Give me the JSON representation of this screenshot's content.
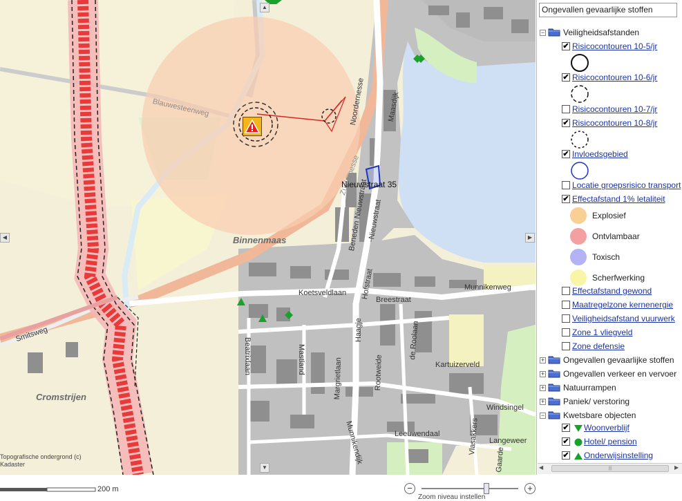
{
  "map": {
    "labels": {
      "blauwesteenweg": "Blauwesteenweg",
      "noordernesse": "Noordernesse",
      "maasdijk": "Maasdijk",
      "zuidernesse": "Zuidernesse",
      "nieuwstraat35": "Nieuwstraat 35",
      "binnenmaas": "Binnenmaas",
      "beneden_nieuwstraat": "Beneden Nieuwstraat",
      "nieuwstraat": "Nieuwstraat",
      "koetsveldlaan": "Koetsveldlaan",
      "hofstraat": "Hofstraat",
      "breestraat": "Breestraat",
      "munnikenweg": "Munnikenweg",
      "smitsweg": "Smitsweg",
      "beatrixlaan": "Beatrixlaan",
      "mastland": "Mastland",
      "margrietlaan": "Margrietlaan",
      "haagje": "Haagje",
      "rootweide": "Rootweide",
      "de_roolaan": "de Roolaan",
      "kartuizerveld": "Kartuizerveld",
      "cromstrijen": "Cromstrijen",
      "windsingel": "Windsingel",
      "leeuwendaal": "Leeuwendaal",
      "vlasakkers": "Vlasakkers",
      "langeweer": "Langeweer",
      "gaarde": "Gaarde",
      "munnikendijk": "Munnikendijk"
    },
    "copyright_line1": "Topografische ondergrond (c)",
    "copyright_line2": "Kadaster",
    "pan_up": "▲",
    "pan_down": "▼",
    "pan_left": "◀",
    "pan_right": "▶"
  },
  "scale": {
    "label": "200 m"
  },
  "zoom": {
    "minus": "−",
    "plus": "+",
    "level_fraction": 0.68,
    "caption": "Zoom niveau instellen"
  },
  "panel": {
    "selected_layer": "Ongevallen gevaarlijke stoffen",
    "groups": [
      {
        "label": "Veiligheidsafstanden",
        "expanded": true
      },
      {
        "label": "Ongevallen gevaarlijke stoffen",
        "expanded": false
      },
      {
        "label": "Ongevallen verkeer en vervoer",
        "expanded": false
      },
      {
        "label": "Natuurrampen",
        "expanded": false
      },
      {
        "label": "Paniek/ verstoring",
        "expanded": false
      },
      {
        "label": "Kwetsbare objecten",
        "expanded": true
      }
    ],
    "layers": [
      {
        "label": "Risicocontouren 10-5/jr",
        "checked": true
      },
      {
        "label": "Risicocontouren 10-6/jr",
        "checked": true
      },
      {
        "label": "Risicocontouren 10-7/jr",
        "checked": false
      },
      {
        "label": "Risicocontouren 10-8/jr",
        "checked": true
      },
      {
        "label": "Invloedsgebied",
        "checked": true
      },
      {
        "label": "Locatie groepsrisico transport",
        "checked": false
      },
      {
        "label": "Effectafstand 1% letaliteit",
        "checked": true
      },
      {
        "label": "Effectafstand gewond",
        "checked": false
      },
      {
        "label": "Maatregelzone kernenergie",
        "checked": false
      },
      {
        "label": "Veiligheidsafstand vuurwerk",
        "checked": false
      },
      {
        "label": "Zone 1 vliegveld",
        "checked": false
      },
      {
        "label": "Zone defensie",
        "checked": false
      }
    ],
    "effect_legend": [
      {
        "label": "Explosief",
        "color": "#f9cf93"
      },
      {
        "label": "Ontvlambaar",
        "color": "#f5a0a0"
      },
      {
        "label": "Toxisch",
        "color": "#b3b3f5"
      },
      {
        "label": "Scherfwerking",
        "color": "#f8f6a6"
      }
    ],
    "kwetsbaar": [
      {
        "label": "Woonverblijf",
        "checked": true,
        "color": "#1aa12c"
      },
      {
        "label": "Hotel/ pension",
        "checked": true,
        "color": "#1aa12c"
      },
      {
        "label": "Onderwijsinstelling",
        "checked": true,
        "color": "#1aa12c"
      }
    ],
    "check_mark": "✔",
    "collapse_sign": "−",
    "expand_sign": "+",
    "scroll_left": "◀",
    "scroll_right": "▶",
    "scroll_grip": "|||"
  },
  "colors": {
    "risk_zone": "#f9cdb0",
    "pipeline": "#e83a3a",
    "water": "#cfe0f5",
    "built": "#bdbdbd",
    "building": "#8f8f8f",
    "meadow": "#f2efd8",
    "green": "#d6efc0",
    "link": "#1a33a8"
  }
}
